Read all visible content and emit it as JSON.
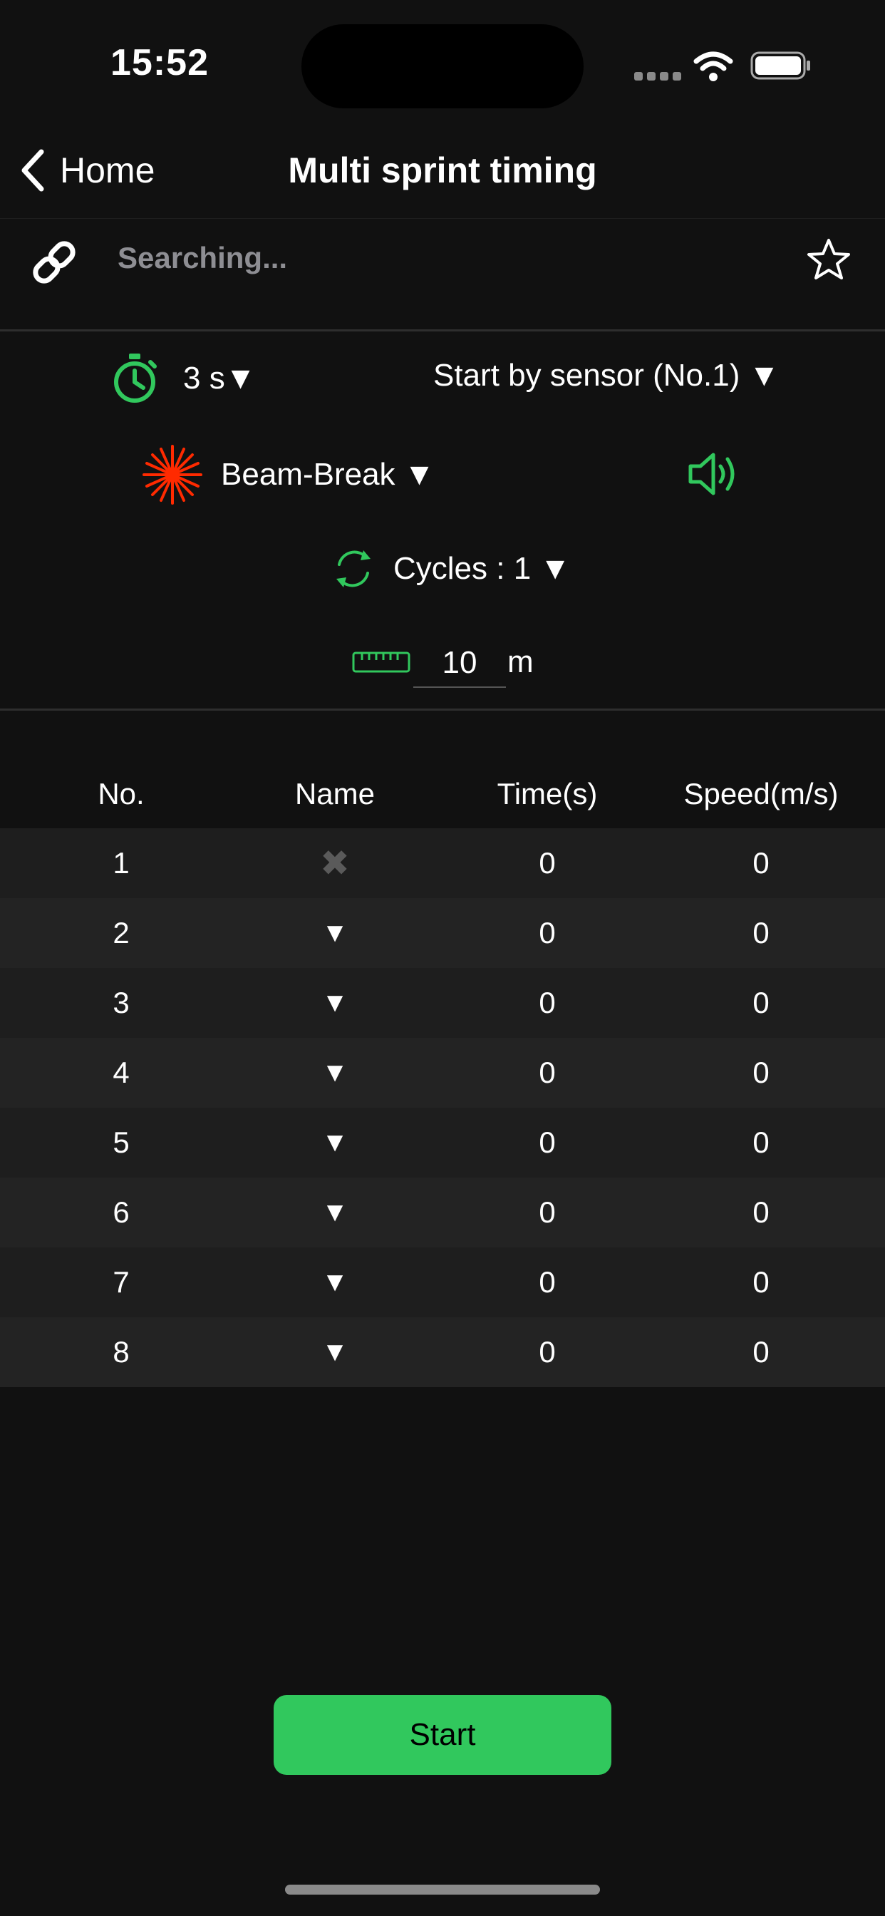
{
  "status_bar": {
    "time": "15:52"
  },
  "nav": {
    "back_label": "Home",
    "title": "Multi sprint timing"
  },
  "connection": {
    "status": "Searching..."
  },
  "settings": {
    "countdown": "3 s▼",
    "start_mode": "Start by sensor (No.1) ▼",
    "sensor_mode": "Beam-Break ▼",
    "cycles": "Cycles : 1 ▼",
    "distance_value": "10",
    "distance_unit": "m"
  },
  "table": {
    "headers": {
      "no": "No.",
      "name": "Name",
      "time": "Time(s)",
      "speed": "Speed(m/s)"
    },
    "rows": [
      {
        "no": "1",
        "name": "✖",
        "time": "0",
        "speed": "0"
      },
      {
        "no": "2",
        "name": "▼",
        "time": "0",
        "speed": "0"
      },
      {
        "no": "3",
        "name": "▼",
        "time": "0",
        "speed": "0"
      },
      {
        "no": "4",
        "name": "▼",
        "time": "0",
        "speed": "0"
      },
      {
        "no": "5",
        "name": "▼",
        "time": "0",
        "speed": "0"
      },
      {
        "no": "6",
        "name": "▼",
        "time": "0",
        "speed": "0"
      },
      {
        "no": "7",
        "name": "▼",
        "time": "0",
        "speed": "0"
      },
      {
        "no": "8",
        "name": "▼",
        "time": "0",
        "speed": "0"
      }
    ]
  },
  "start_button": {
    "label": "Start"
  },
  "colors": {
    "accent_green": "#31c85d",
    "laser_red": "#ff2a00",
    "background": "#111111",
    "muted_text": "#8e8e93"
  },
  "icons": {
    "back": "chevron-left-icon",
    "link": "link-icon",
    "favorite": "star-icon",
    "timer": "stopwatch-icon",
    "sensor": "laser-burst-icon",
    "sound": "speaker-icon",
    "cycles": "refresh-icon",
    "distance": "ruler-icon"
  }
}
